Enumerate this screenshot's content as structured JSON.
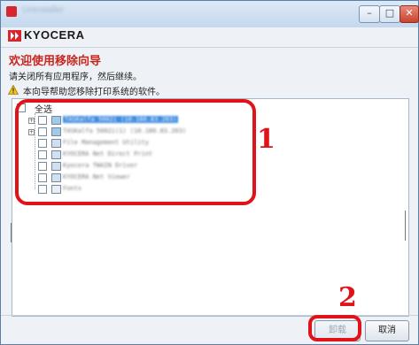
{
  "window": {
    "title": "Uninstaller",
    "minimize_label": "–",
    "maximize_label": "□",
    "close_label": "✕"
  },
  "brand": {
    "logo_text": "KYOCERA",
    "logo_color": "#d7262e"
  },
  "wizard": {
    "heading": "欢迎使用移除向导",
    "instruction": "请关闭所有应用程序，然后继续。",
    "info_text": "本向导帮助您移除打印系统的软件。"
  },
  "tree": {
    "select_all_label": "全选",
    "items": [
      {
        "label": "TASKalfa 5002i (10.180.83.203)",
        "icon": "printer-icon",
        "expandable": true,
        "highlighted": true
      },
      {
        "label": "TASKalfa 5002i(1) (10.180.83.203)",
        "icon": "printer-icon",
        "expandable": true,
        "highlighted": false
      },
      {
        "label": "File Management Utility",
        "icon": "app-icon",
        "expandable": false,
        "highlighted": false
      },
      {
        "label": "KYOCERA Net Direct Print",
        "icon": "app-icon",
        "expandable": false,
        "highlighted": false
      },
      {
        "label": "Kyocera TWAIN Driver",
        "icon": "app-icon",
        "expandable": false,
        "highlighted": false
      },
      {
        "label": "KYOCERA Net Viewer",
        "icon": "app-icon",
        "expandable": false,
        "highlighted": false
      },
      {
        "label": "Fonts",
        "icon": "font-icon",
        "expandable": false,
        "highlighted": false
      }
    ]
  },
  "annotations": {
    "step1": "1",
    "step2": "2",
    "color": "#e0121a"
  },
  "buttons": {
    "uninstall_label": "卸载",
    "cancel_label": "取消"
  }
}
